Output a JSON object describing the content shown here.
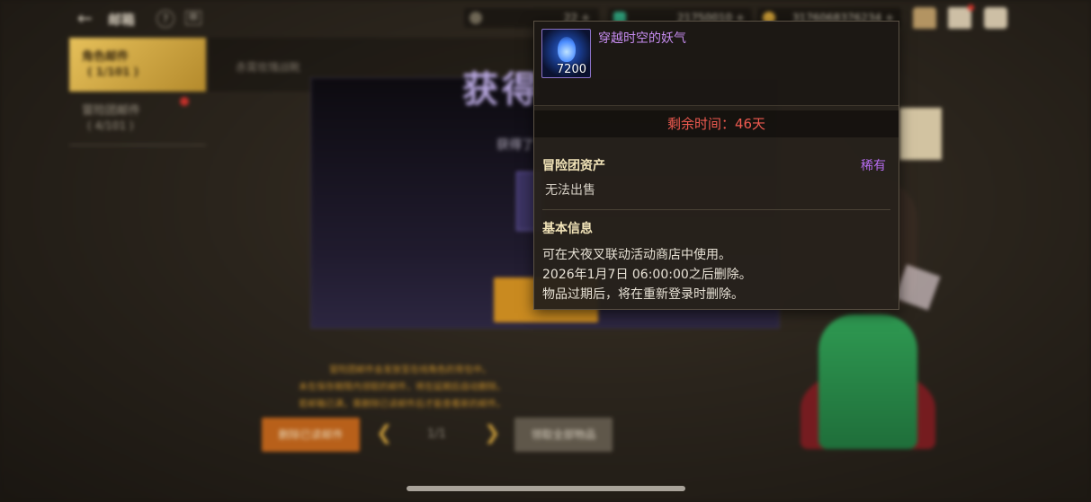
{
  "header": {
    "back_icon": "arrow-left-icon",
    "title": "邮箱",
    "help_icon": "question-icon",
    "book_icon": "book-icon",
    "currencies": [
      {
        "icon": "coin-c-icon",
        "value": "22 +"
      },
      {
        "icon": "crystal-icon",
        "value": "21750010 +"
      },
      {
        "icon": "gold-icon",
        "value": "3176068376234 +"
      }
    ],
    "right_icons": [
      "chest-icon",
      "mail-icon",
      "chat-icon"
    ]
  },
  "tabs": [
    {
      "label": "角色邮件",
      "count": "( 1/101 )",
      "active": true
    },
    {
      "label": "冒险团邮件",
      "count": "( 4/101 )",
      "active": false
    }
  ],
  "mail_list": [
    {
      "subject": "赤霄玫瑰战靴"
    }
  ],
  "reward_panel": {
    "heading": "获得",
    "subtitle": "获得了"
  },
  "notices": [
    "冒险团邮件会发放至在线角色的背包中。",
    "未在保存期限内领取的邮件，将在延期后自动删除。",
    "若邮箱已满，需删除已读邮件后才能查看新的邮件。"
  ],
  "footer": {
    "delete_button": "删除已读邮件",
    "page": "1/1",
    "claim_all_button": "领取全部物品"
  },
  "tooltip": {
    "item_name": "穿越时空的妖气",
    "item_icon": "blue-flame-icon",
    "quantity": "7200",
    "remaining_time": "剩余时间：46天",
    "asset_type": "冒险团资产",
    "rarity": "稀有",
    "sell_status": "无法出售",
    "basic_info_title": "基本信息",
    "description": [
      "可在犬夜叉联动活动商店中使用。",
      "2026年1月7日 06:00:00之后删除。",
      "物品过期后，将在重新登录时删除。"
    ]
  },
  "colors": {
    "item_name": "#c68cf0",
    "rarity": "#b66cf0",
    "remaining_time": "#ef5a50",
    "active_tab": "#d9b24a"
  }
}
